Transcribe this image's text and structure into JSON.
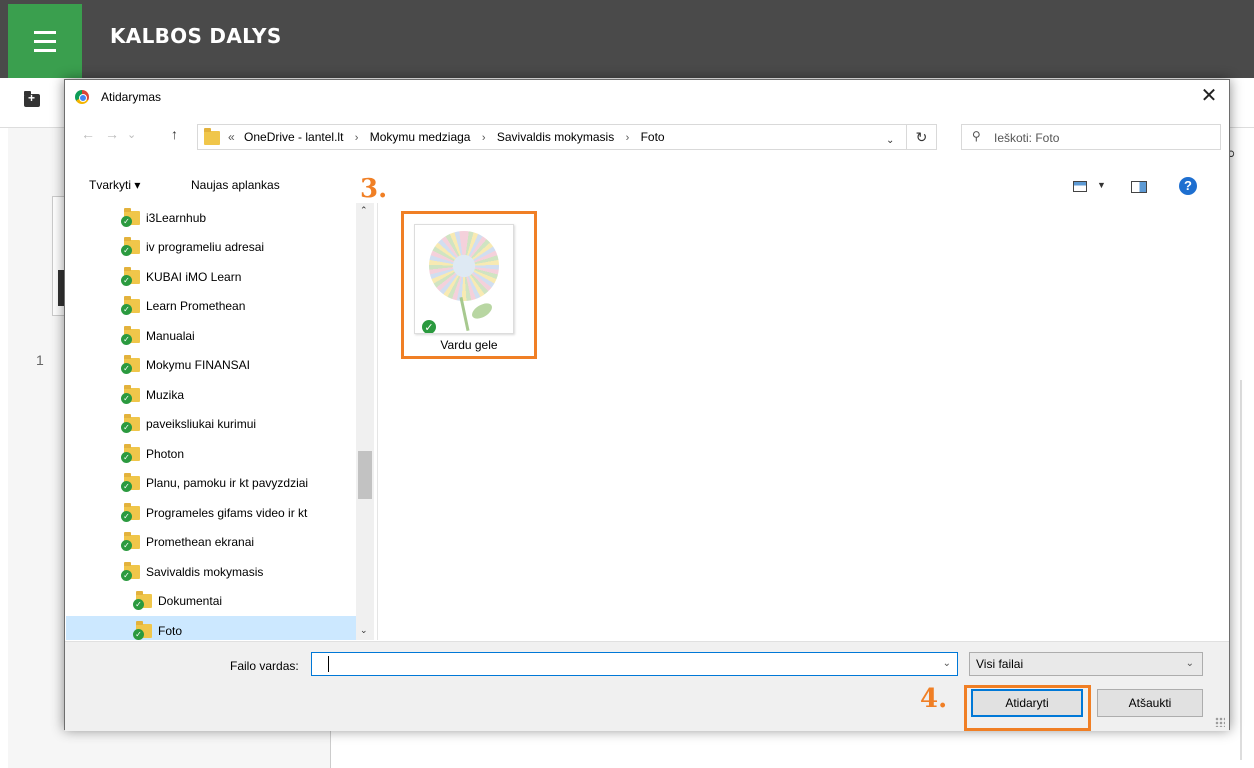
{
  "app": {
    "title": "KALBOS DALYS",
    "page_number": "1"
  },
  "dialog": {
    "title": "Atidarymas",
    "close_label": "✕",
    "nav": {
      "back": "←",
      "forward": "→",
      "recent": "⌄",
      "up": "↑"
    },
    "breadcrumb": [
      "OneDrive - lantel.lt",
      "Mokymu medziaga",
      "Savivaldis mokymasis",
      "Foto"
    ],
    "breadcrumb_prefix": "«",
    "search_placeholder": "Ieškoti: Foto",
    "toolbar": {
      "organize": "Tvarkyti ▾",
      "new_folder": "Naujas aplankas"
    },
    "tree": [
      {
        "label": "i3Learnhub",
        "indent": 1
      },
      {
        "label": "iv programeliu adresai",
        "indent": 1
      },
      {
        "label": "KUBAI iMO Learn",
        "indent": 1
      },
      {
        "label": "Learn Promethean",
        "indent": 1
      },
      {
        "label": "Manualai",
        "indent": 1
      },
      {
        "label": "Mokymu FINANSAI",
        "indent": 1
      },
      {
        "label": "Muzika",
        "indent": 1
      },
      {
        "label": "paveiksliukai kurimui",
        "indent": 1
      },
      {
        "label": "Photon",
        "indent": 1
      },
      {
        "label": "Planu, pamoku ir kt pavyzdziai",
        "indent": 1
      },
      {
        "label": "Programeles gifams video ir kt",
        "indent": 1
      },
      {
        "label": "Promethean ekranai",
        "indent": 1
      },
      {
        "label": "Savivaldis mokymasis",
        "indent": 1
      },
      {
        "label": "Dokumentai",
        "indent": 2
      },
      {
        "label": "Foto",
        "indent": 2,
        "selected": true
      }
    ],
    "files": [
      {
        "name": "Vardu gele",
        "icon": "image-thumbnail"
      }
    ],
    "filename_label": "Failo vardas:",
    "filename_value": "",
    "filetype_value": "Visi failai",
    "open_button": "Atidaryti",
    "cancel_button": "Atšaukti"
  },
  "annotations": {
    "step3": "3.",
    "step4": "4.",
    "highlight_color": "#f07f25"
  }
}
